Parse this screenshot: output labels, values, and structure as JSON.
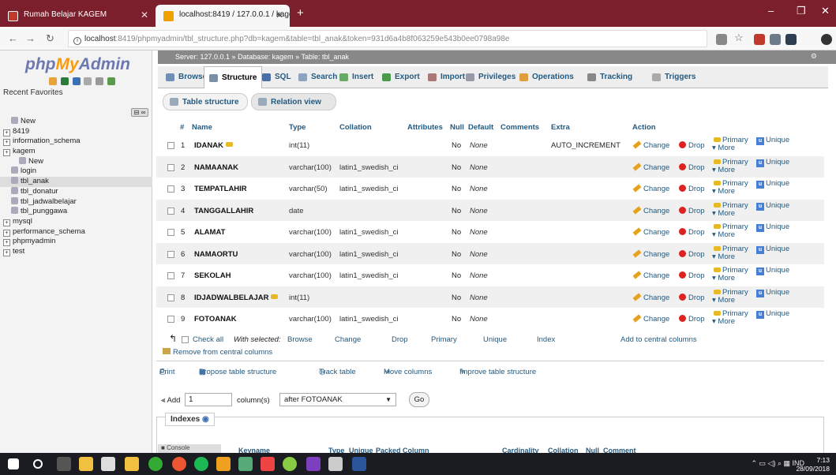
{
  "browser": {
    "tabs": [
      {
        "title": "Rumah Belajar KAGEM",
        "active": false
      },
      {
        "title": "localhost:8419 / 127.0.0.1 / kage",
        "active": true
      }
    ],
    "new_tab": "+",
    "url_host": "localhost",
    "url_rest": ":8419/phpmyadmin/tbl_structure.php?db=kagem&table=tbl_anak&token=931d6a4b8f063259e543b0ee0798a98e",
    "window_controls": [
      "–",
      "❐",
      "✕"
    ]
  },
  "sidebar": {
    "logo_php": "php",
    "logo_my": "My",
    "logo_admin": "Admin",
    "recent": "Recent",
    "favorites": "Favorites",
    "tree": [
      {
        "label": "New",
        "depth": 1,
        "kind": "new"
      },
      {
        "label": "8419",
        "depth": 0,
        "kind": "db"
      },
      {
        "label": "information_schema",
        "depth": 0,
        "kind": "db"
      },
      {
        "label": "kagem",
        "depth": 0,
        "kind": "db"
      },
      {
        "label": "New",
        "depth": 2,
        "kind": "new"
      },
      {
        "label": "login",
        "depth": 1,
        "kind": "table"
      },
      {
        "label": "tbl_anak",
        "depth": 1,
        "kind": "table",
        "active": true
      },
      {
        "label": "tbl_donatur",
        "depth": 1,
        "kind": "table"
      },
      {
        "label": "tbl_jadwalbelajar",
        "depth": 1,
        "kind": "table"
      },
      {
        "label": "tbl_punggawa",
        "depth": 1,
        "kind": "table"
      },
      {
        "label": "mysql",
        "depth": 0,
        "kind": "db"
      },
      {
        "label": "performance_schema",
        "depth": 0,
        "kind": "db"
      },
      {
        "label": "phpmyadmin",
        "depth": 0,
        "kind": "db"
      },
      {
        "label": "test",
        "depth": 0,
        "kind": "db"
      }
    ]
  },
  "breadcrumb": {
    "server": "Server: 127.0.0.1 »",
    "database": "Database: kagem »",
    "table": "Table: tbl_anak"
  },
  "menu": [
    "Browse",
    "Structure",
    "SQL",
    "Search",
    "Insert",
    "Export",
    "Import",
    "Privileges",
    "Operations",
    "Tracking",
    "Triggers"
  ],
  "subtabs": [
    "Table structure",
    "Relation view"
  ],
  "table": {
    "headers": [
      "#",
      "Name",
      "Type",
      "Collation",
      "Attributes",
      "Null",
      "Default",
      "Comments",
      "Extra",
      "Action"
    ],
    "rows": [
      {
        "num": "1",
        "name": "IDANAK",
        "key": true,
        "type": "int(11)",
        "collation": "",
        "null": "No",
        "default": "None",
        "extra": "AUTO_INCREMENT"
      },
      {
        "num": "2",
        "name": "NAMAANAK",
        "key": false,
        "type": "varchar(100)",
        "collation": "latin1_swedish_ci",
        "null": "No",
        "default": "None",
        "extra": ""
      },
      {
        "num": "3",
        "name": "TEMPATLAHIR",
        "key": false,
        "type": "varchar(50)",
        "collation": "latin1_swedish_ci",
        "null": "No",
        "default": "None",
        "extra": ""
      },
      {
        "num": "4",
        "name": "TANGGALLAHIR",
        "key": false,
        "type": "date",
        "collation": "",
        "null": "No",
        "default": "None",
        "extra": ""
      },
      {
        "num": "5",
        "name": "ALAMAT",
        "key": false,
        "type": "varchar(100)",
        "collation": "latin1_swedish_ci",
        "null": "No",
        "default": "None",
        "extra": ""
      },
      {
        "num": "6",
        "name": "NAMAORTU",
        "key": false,
        "type": "varchar(100)",
        "collation": "latin1_swedish_ci",
        "null": "No",
        "default": "None",
        "extra": ""
      },
      {
        "num": "7",
        "name": "SEKOLAH",
        "key": false,
        "type": "varchar(100)",
        "collation": "latin1_swedish_ci",
        "null": "No",
        "default": "None",
        "extra": ""
      },
      {
        "num": "8",
        "name": "IDJADWALBELAJAR",
        "key": true,
        "type": "int(11)",
        "collation": "",
        "null": "No",
        "default": "None",
        "extra": ""
      },
      {
        "num": "9",
        "name": "FOTOANAK",
        "key": false,
        "type": "varchar(100)",
        "collation": "latin1_swedish_ci",
        "null": "No",
        "default": "None",
        "extra": ""
      }
    ],
    "actions": {
      "change": "Change",
      "drop": "Drop",
      "primary": "Primary",
      "unique": "Unique",
      "more": "More"
    }
  },
  "with_selected": {
    "check_all": "Check all",
    "label": "With selected:",
    "items": [
      "Browse",
      "Change",
      "Drop",
      "Primary",
      "Unique",
      "Index",
      "Add to central columns"
    ],
    "remove_central": "Remove from central columns"
  },
  "tools": [
    "Print",
    "Propose table structure",
    "Track table",
    "Move columns",
    "Improve table structure"
  ],
  "add_columns": {
    "label": "Add",
    "value": "1",
    "suffix": "column(s)",
    "position": "after FOTOANAK",
    "go": "Go"
  },
  "indexes": {
    "title": "Indexes",
    "console": "Console",
    "headers": [
      "Keyname",
      "Type",
      "Unique",
      "Packed",
      "Column",
      "Cardinality",
      "Collation",
      "Null",
      "Comment"
    ]
  },
  "taskbar": {
    "lang": "IND",
    "time": "7:13",
    "date": "28/09/2018"
  }
}
